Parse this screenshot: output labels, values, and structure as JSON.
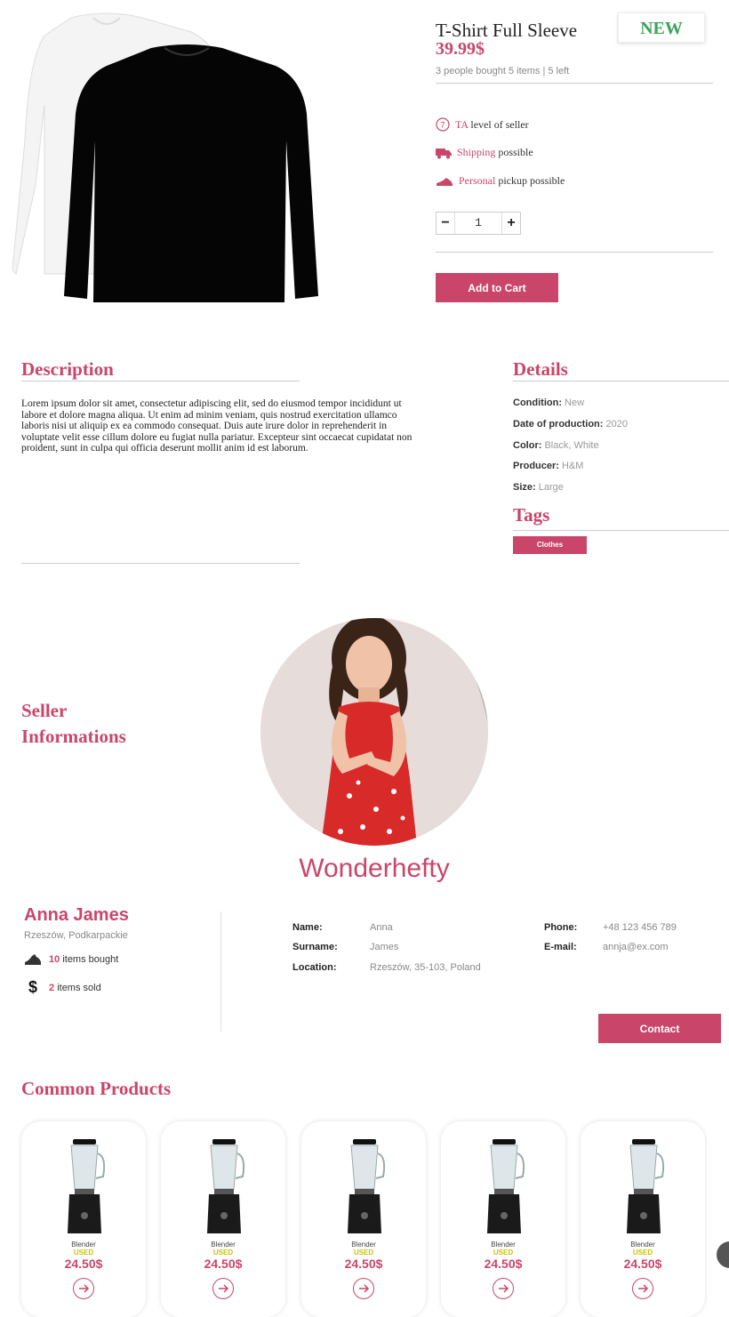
{
  "product": {
    "title": "T-Shirt Full Sleeve",
    "badge": "NEW",
    "price": "39.99$",
    "stats": "3 people bought 5 items | 5 left",
    "features": [
      {
        "icon": "level-icon",
        "em": "TA",
        "text": " level of seller"
      },
      {
        "icon": "truck-icon",
        "em": "Shipping",
        "text": " possible"
      },
      {
        "icon": "shoe-icon",
        "em": "Personal",
        "text": " pickup possible"
      }
    ],
    "quantity": "1",
    "add_to_cart": "Add to Cart",
    "colors": {
      "accent": "#c9466a",
      "badge": "#3ea35a"
    }
  },
  "description": {
    "heading": "Description",
    "text": "Lorem ipsum dolor sit amet, consectetur adipiscing elit, sed do eiusmod tempor incididunt ut labore et dolore magna aliqua. Ut enim ad minim veniam, quis nostrud exercitation ullamco laboris nisi ut aliquip ex ea  commodo consequat. Duis aute irure dolor in reprehenderit in voluptate velit esse cillum dolore eu fugiat nulla pariatur. Excepteur sint occaecat cupidatat non proident, sunt in culpa qui officia deserunt mollit anim id est laborum."
  },
  "details": {
    "heading": "Details",
    "rows": [
      {
        "k": "Condition:",
        "v": "New"
      },
      {
        "k": "Date of production:",
        "v": "2020"
      },
      {
        "k": "Color:",
        "v": "Black, White"
      },
      {
        "k": "Producer:",
        "v": "H&M"
      },
      {
        "k": "Size:",
        "v": "Large"
      }
    ],
    "tags_heading": "Tags",
    "tag": "Clothes"
  },
  "seller": {
    "heading_line1": "Seller",
    "heading_line2": "Informations",
    "shop_name": "Wonderhefty",
    "full_name": "Anna James",
    "region": "Rzeszów, Podkarpackie",
    "bought_count": "10",
    "bought_label": "items bought",
    "sold_count": "2",
    "sold_label": "items sold",
    "info": {
      "name_k": "Name:",
      "name_v": "Anna",
      "surname_k": "Surname:",
      "surname_v": "James",
      "location_k": "Location:",
      "location_v": "Rzeszów, 35-103, Poland",
      "phone_k": "Phone:",
      "phone_v": "+48 123 456 789",
      "email_k": "E-mail:",
      "email_v": "annja@ex.com"
    },
    "contact": "Contact"
  },
  "common": {
    "heading": "Common Products",
    "items": [
      {
        "name": "Blender",
        "condition": "USED",
        "price": "24.50$"
      },
      {
        "name": "Blender",
        "condition": "USED",
        "price": "24.50$"
      },
      {
        "name": "Blender",
        "condition": "USED",
        "price": "24.50$"
      },
      {
        "name": "Blender",
        "condition": "USED",
        "price": "24.50$"
      },
      {
        "name": "Blender",
        "condition": "USED",
        "price": "24.50$"
      }
    ]
  }
}
